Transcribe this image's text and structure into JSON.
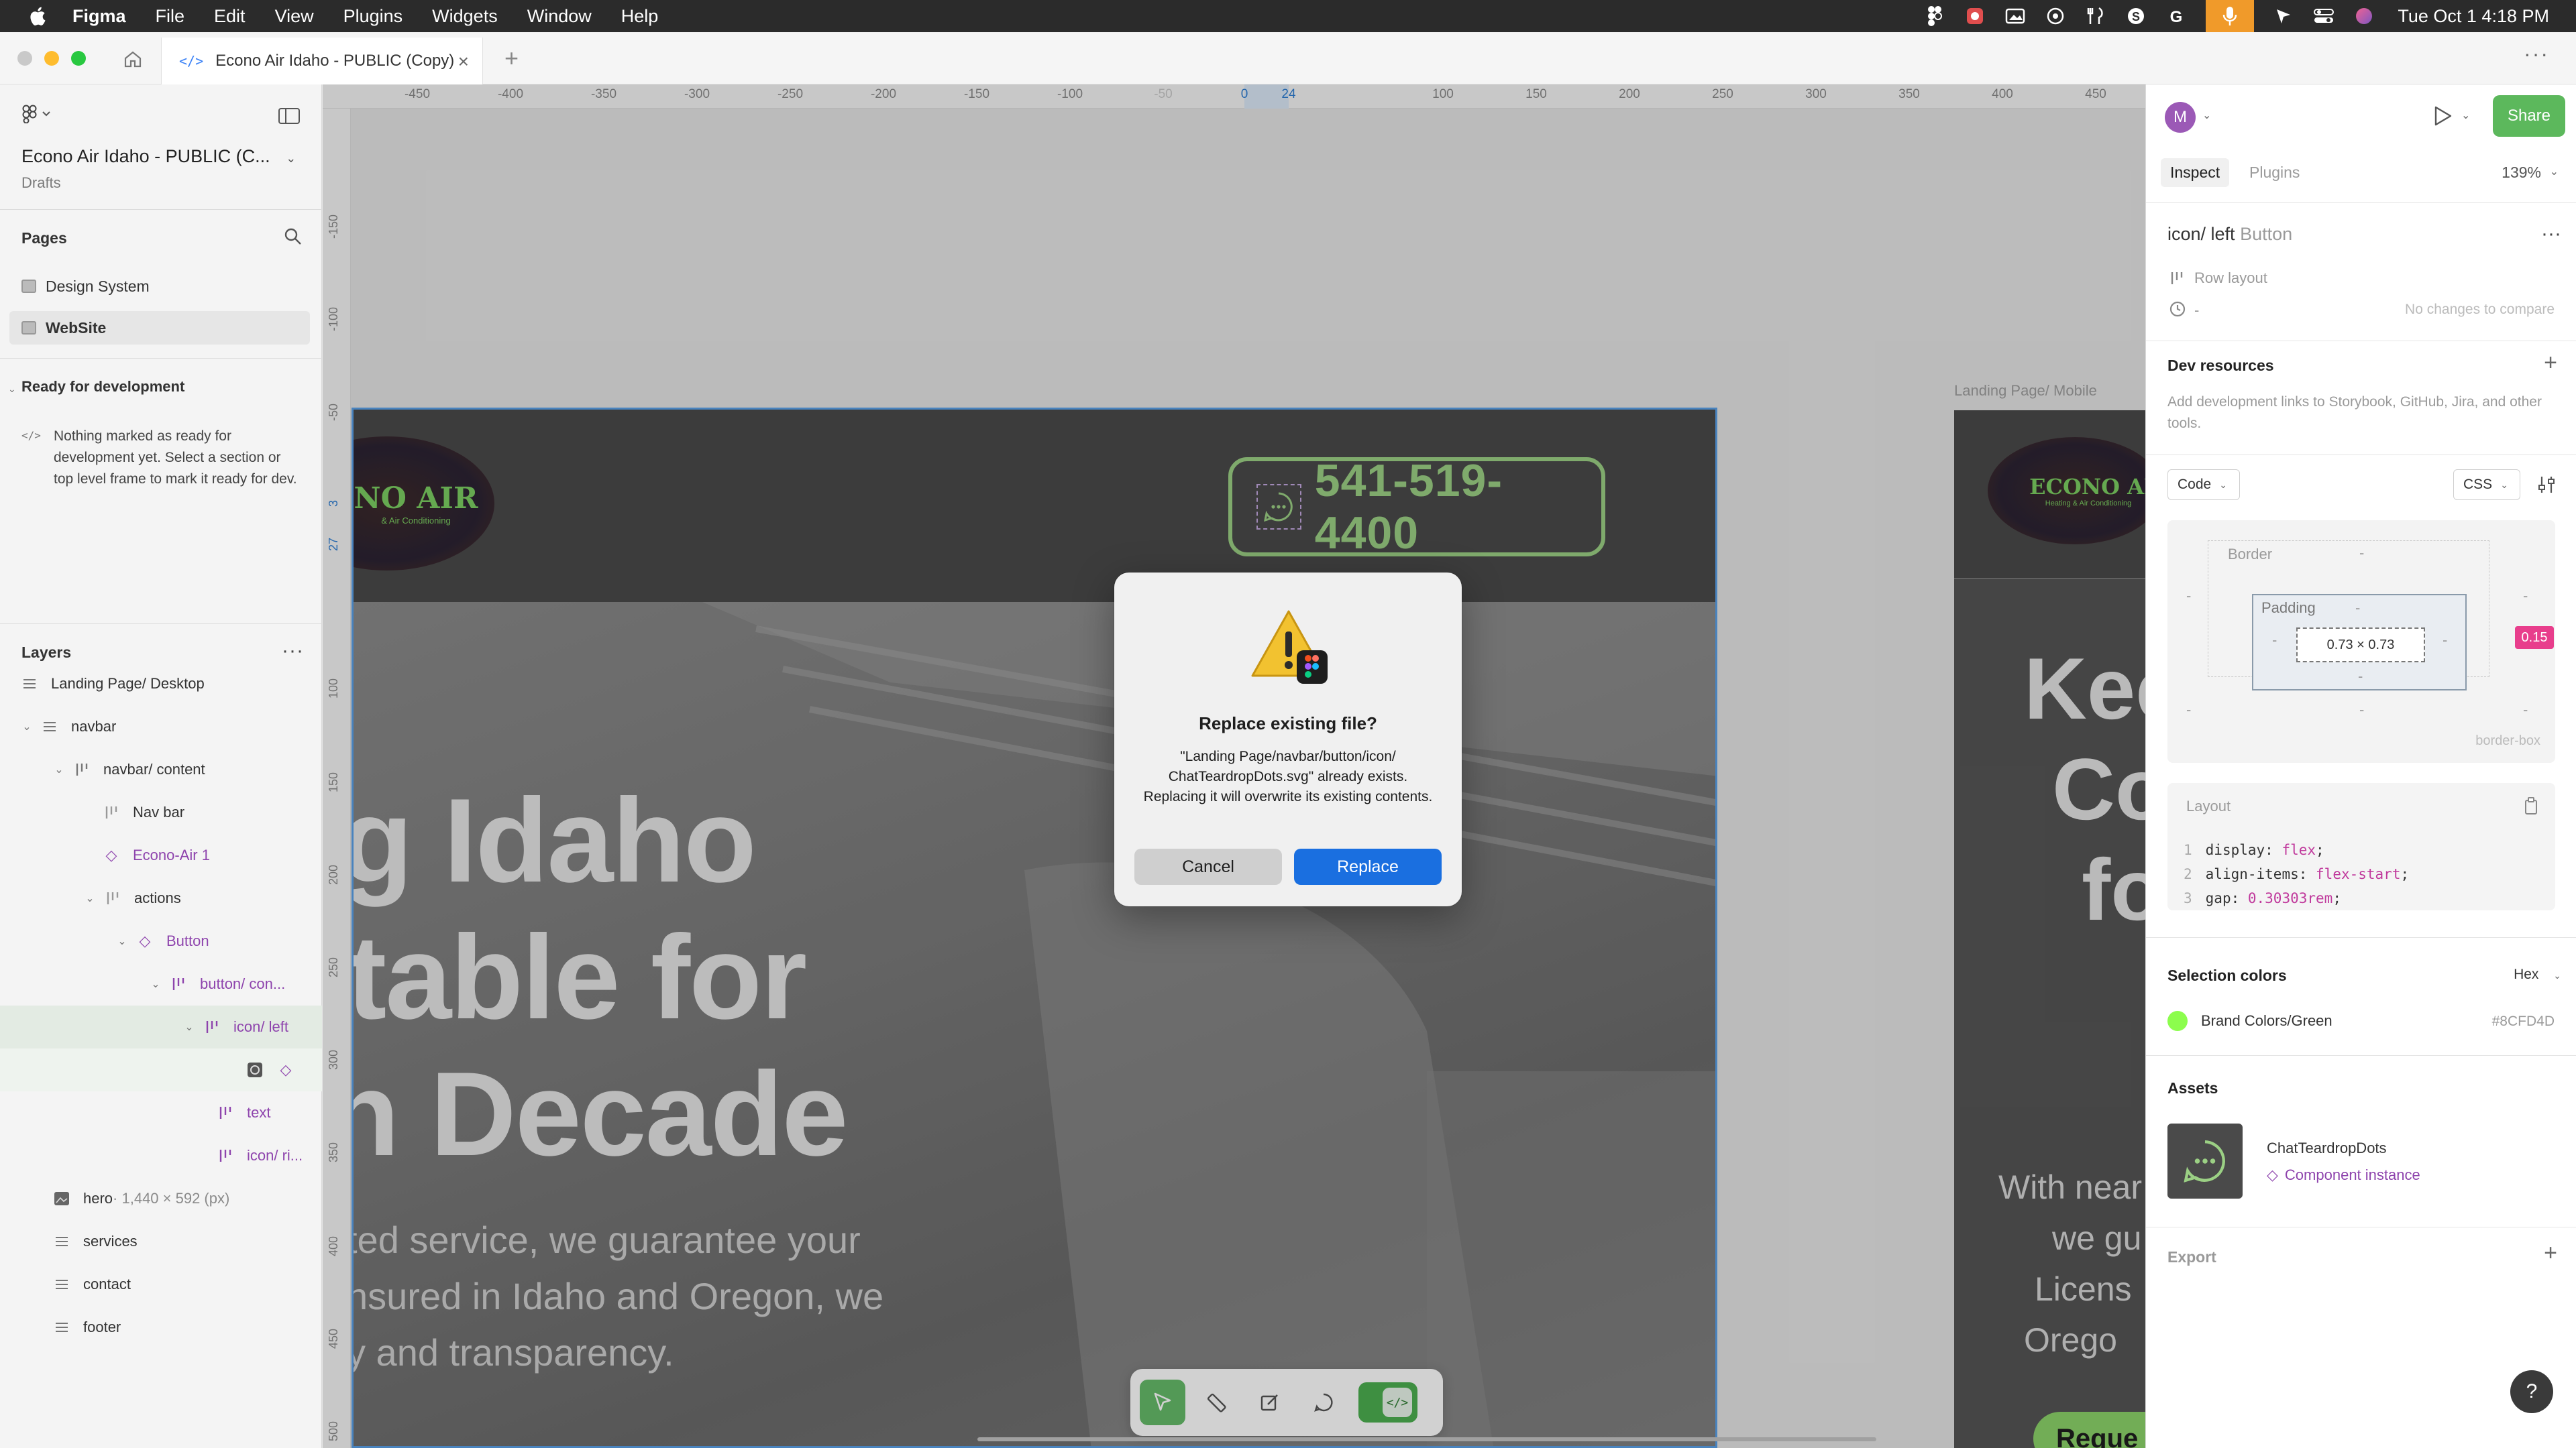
{
  "menubar": {
    "app": "Figma",
    "items": [
      "File",
      "Edit",
      "View",
      "Plugins",
      "Widgets",
      "Window",
      "Help"
    ],
    "clock": "Tue Oct 1  4:18 PM"
  },
  "window": {
    "tab_title": "Econo Air Idaho - PUBLIC (Copy)"
  },
  "left_panel": {
    "file_name": "Econo Air Idaho - PUBLIC (C...",
    "file_location": "Drafts",
    "pages_label": "Pages",
    "pages": [
      {
        "label": "Design System"
      },
      {
        "label": "WebSite"
      }
    ],
    "ready_label": "Ready for development",
    "ready_note": "Nothing marked as ready for development yet. Select a section or top level frame to mark it ready for dev.",
    "layers_label": "Layers",
    "layers": [
      {
        "label": "Landing Page/ Desktop",
        "kind": "frame"
      },
      {
        "label": "navbar",
        "kind": "frame"
      },
      {
        "label": "navbar/ content",
        "kind": "autolayout"
      },
      {
        "label": "Nav bar",
        "kind": "autolayout"
      },
      {
        "label": "Econo-Air 1",
        "kind": "component"
      },
      {
        "label": "actions",
        "kind": "autolayout"
      },
      {
        "label": "Button",
        "kind": "component"
      },
      {
        "label": "button/ con...",
        "kind": "autolayout"
      },
      {
        "label": "icon/ left",
        "kind": "autolayout"
      },
      {
        "label": "",
        "kind": "instance"
      },
      {
        "label": "text",
        "kind": "autolayout"
      },
      {
        "label": "icon/ ri...",
        "kind": "autolayout"
      },
      {
        "label": "hero",
        "kind": "image",
        "meta": " · 1,440 × 592 (px)"
      },
      {
        "label": "services",
        "kind": "frame"
      },
      {
        "label": "contact",
        "kind": "frame"
      },
      {
        "label": "footer",
        "kind": "frame"
      }
    ]
  },
  "canvas": {
    "ruler_x": [
      "-450",
      "-400",
      "-350",
      "-300",
      "-250",
      "-200",
      "-150",
      "-100",
      "-50",
      "0",
      "24",
      "100",
      "150",
      "200",
      "250",
      "300",
      "350",
      "400",
      "450"
    ],
    "ruler_y": [
      "-150",
      "-100",
      "-50",
      "3",
      "27",
      "100",
      "150",
      "200",
      "250",
      "300",
      "350",
      "400",
      "450",
      "500"
    ],
    "desktop": {
      "logo_text": "NO AIR",
      "logo_sub": "& Air Conditioning",
      "phone": "541-519-4400",
      "hero_lines": [
        "g Idaho",
        "table for",
        "n Decade"
      ],
      "sub_lines": [
        "ted service, we guarantee your",
        "nsured in Idaho and Oregon, we",
        "y and transparency."
      ]
    },
    "mobile": {
      "label": "Landing Page/ Mobile",
      "logo_text": "ECONO AI",
      "logo_sub": "Heating & Air Conditioning",
      "head_lines": [
        "Kee",
        "Co",
        "fo"
      ],
      "sub_lines": [
        "With near",
        "we gu",
        "Licens",
        "Orego"
      ],
      "cta": "Reque"
    }
  },
  "dialog": {
    "title": "Replace existing file?",
    "message": "\"Landing Page/navbar/button/icon/ ChatTeardropDots.svg\" already exists. Replacing it will overwrite its existing contents.",
    "cancel": "Cancel",
    "replace": "Replace"
  },
  "right_panel": {
    "avatar": "M",
    "share": "Share",
    "tabs": [
      "Inspect",
      "Plugins"
    ],
    "zoom": "139%",
    "selection_name": "icon/ left",
    "selection_type": "Button",
    "layout_type": "Row layout",
    "history_value": "-",
    "history_note": "No changes to compare",
    "dev_resources_label": "Dev resources",
    "dev_resources_note": "Add development links to Storybook, GitHub, Jira, and other tools.",
    "code_dropdown": "Code",
    "lang_dropdown": "CSS",
    "box_model": {
      "border_label": "Border",
      "padding_label": "Padding",
      "content_size": "0.73 × 0.73",
      "gap_badge": "0.15",
      "dash": "-",
      "sizing": "border-box"
    },
    "layout_label": "Layout",
    "code": [
      {
        "n": "1",
        "prop": "display: ",
        "val": "flex",
        "end": ";"
      },
      {
        "n": "2",
        "prop": "align-items: ",
        "val": "flex-start",
        "end": ";"
      },
      {
        "n": "3",
        "prop": "gap: ",
        "val": "0.30303rem",
        "end": ";"
      }
    ],
    "selection_colors_label": "Selection colors",
    "color_format": "Hex",
    "color_name": "Brand Colors/Green",
    "color_hex": "#8CFD4D",
    "assets_label": "Assets",
    "asset_name": "ChatTeardropDots",
    "asset_kind": "Component instance",
    "export_label": "Export",
    "help": "?"
  },
  "colors": {
    "brand_green": "#8CFD4D",
    "selection_blue": "#5aa0e8",
    "replace_blue": "#1a6fe0",
    "share_green": "#5cb85c"
  }
}
